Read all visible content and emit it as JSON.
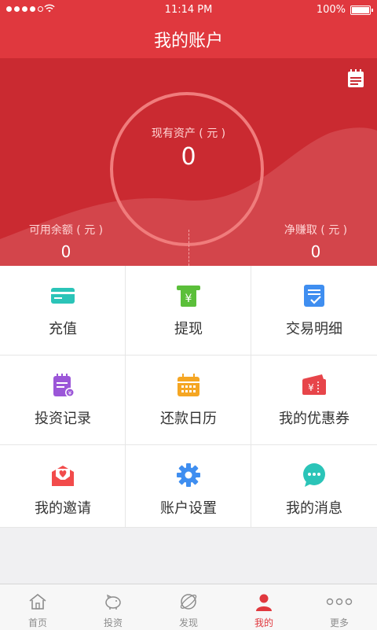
{
  "status_bar": {
    "time": "11:14 PM",
    "battery": "100%"
  },
  "header": {
    "title": "我的账户"
  },
  "assets": {
    "current_label": "现有资产 ( 元 )",
    "current_value": "0",
    "available_label": "可用余额 ( 元 )",
    "available_value": "0",
    "net_label": "净赚取 ( 元 )",
    "net_value": "0"
  },
  "menu": [
    {
      "label": "充值",
      "icon": "card-icon",
      "color": "#2bc4b8"
    },
    {
      "label": "提现",
      "icon": "atm-withdraw-icon",
      "color": "#5bbf3a"
    },
    {
      "label": "交易明细",
      "icon": "checklist-icon",
      "color": "#3f8ef0"
    },
    {
      "label": "投资记录",
      "icon": "investment-record-icon",
      "color": "#9b56d8"
    },
    {
      "label": "还款日历",
      "icon": "calendar-icon",
      "color": "#f5a623"
    },
    {
      "label": "我的优惠券",
      "icon": "coupon-icon",
      "color": "#e7454a"
    },
    {
      "label": "我的邀请",
      "icon": "invite-heart-icon",
      "color": "#f24b4b"
    },
    {
      "label": "账户设置",
      "icon": "gear-icon",
      "color": "#3f8ef0"
    },
    {
      "label": "我的消息",
      "icon": "chat-bubble-icon",
      "color": "#2bc4b8"
    }
  ],
  "tabs": [
    {
      "label": "首页",
      "icon": "home-icon"
    },
    {
      "label": "投资",
      "icon": "piggy-bank-icon"
    },
    {
      "label": "发现",
      "icon": "planet-icon"
    },
    {
      "label": "我的",
      "icon": "user-icon",
      "active": true
    },
    {
      "label": "更多",
      "icon": "more-dots-icon"
    }
  ]
}
